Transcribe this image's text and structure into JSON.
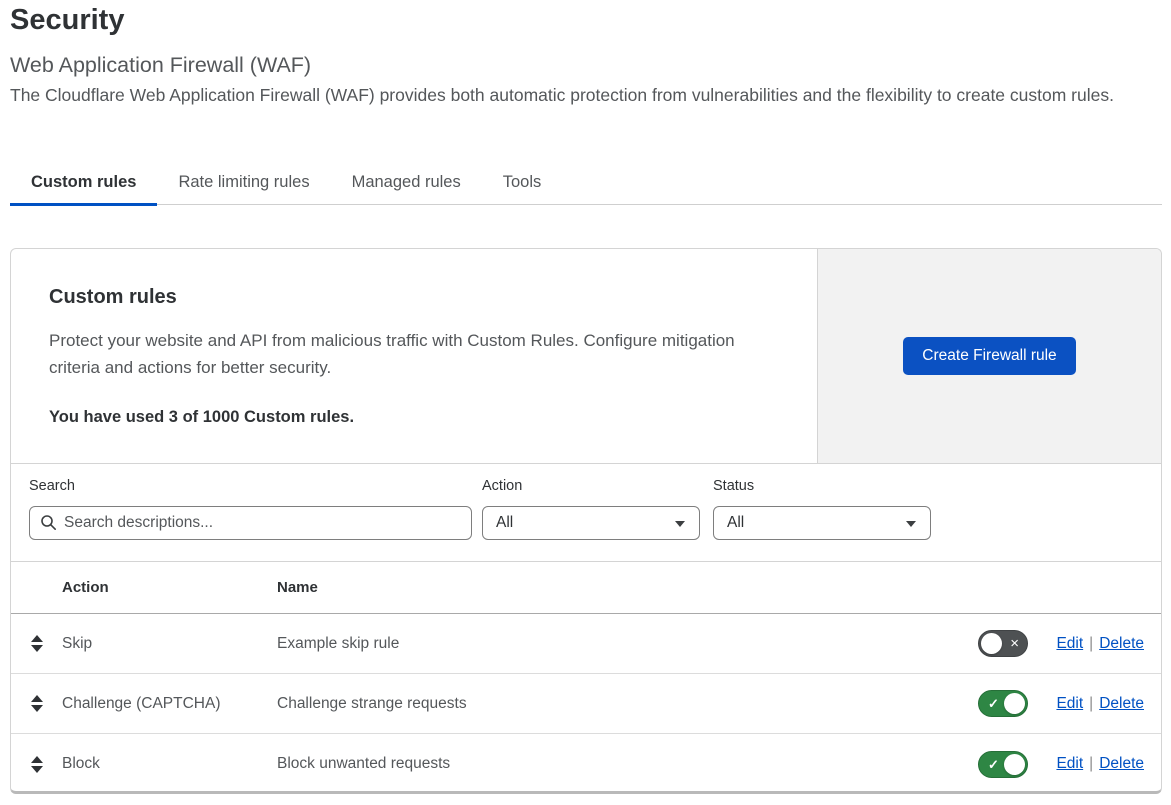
{
  "page": {
    "title": "Security",
    "subtitle": "Web Application Firewall (WAF)",
    "description": "The Cloudflare Web Application Firewall (WAF) provides both automatic protection from vulnerabilities and the flexibility to create custom rules."
  },
  "tabs": [
    {
      "label": "Custom rules",
      "active": true
    },
    {
      "label": "Rate limiting rules",
      "active": false
    },
    {
      "label": "Managed rules",
      "active": false
    },
    {
      "label": "Tools",
      "active": false
    }
  ],
  "hero": {
    "heading": "Custom rules",
    "body": "Protect your website and API from malicious traffic with Custom Rules. Configure mitigation criteria and actions for better security.",
    "usage": "You have used 3 of 1000 Custom rules.",
    "button_label": "Create Firewall rule"
  },
  "filters": {
    "search_label": "Search",
    "search_placeholder": "Search descriptions...",
    "search_value": "",
    "action_label": "Action",
    "action_value": "All",
    "status_label": "Status",
    "status_value": "All"
  },
  "table": {
    "columns": {
      "action": "Action",
      "name": "Name"
    },
    "link_separator": "|",
    "rows": [
      {
        "action": "Skip",
        "name": "Example skip rule",
        "enabled": false,
        "edit_label": "Edit",
        "delete_label": "Delete"
      },
      {
        "action": "Challenge (CAPTCHA)",
        "name": "Challenge strange requests",
        "enabled": true,
        "edit_label": "Edit",
        "delete_label": "Delete"
      },
      {
        "action": "Block",
        "name": "Block unwanted requests",
        "enabled": true,
        "edit_label": "Edit",
        "delete_label": "Delete"
      }
    ]
  },
  "colors": {
    "accent_blue": "#0051c3",
    "button_blue": "#0b51c2",
    "link_blue": "#0051c3",
    "toggle_on_green": "#2e8644",
    "toggle_off_gray": "#4e5153",
    "panel_gray": "#f2f2f2"
  }
}
